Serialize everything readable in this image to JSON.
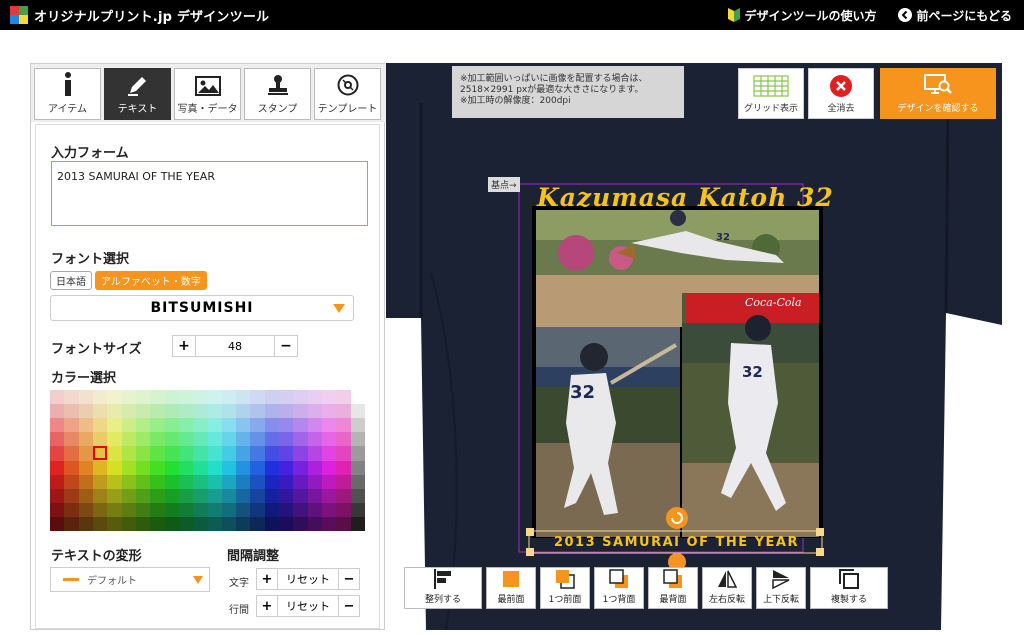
{
  "header": {
    "title": "オリジナルプリント.jp デザインツール",
    "guide_link": "デザインツールの使い方",
    "back_link": "前ページにもどる"
  },
  "tabs": [
    {
      "label": "アイテム",
      "icon": "info-icon"
    },
    {
      "label": "テキスト",
      "icon": "pen-icon"
    },
    {
      "label": "写真・データ",
      "icon": "image-icon"
    },
    {
      "label": "スタンプ",
      "icon": "stamp-icon"
    },
    {
      "label": "テンプレート",
      "icon": "template-icon"
    }
  ],
  "form": {
    "input_label": "入力フォーム",
    "input_value": "2013 SAMURAI OF THE YEAR",
    "font_label": "フォント選択",
    "font_tab_ja": "日本語",
    "font_tab_en": "アルファベット・数字",
    "font_selected": "BITSUMISHI",
    "size_label": "フォントサイズ",
    "size_value": "48",
    "color_label": "カラー選択",
    "transform_label": "テキストの変形",
    "transform_value": "デフォルト",
    "spacing_label": "間隔調整",
    "char_label": "文字",
    "line_label": "行間",
    "reset_label": "リセット"
  },
  "stage": {
    "notice_lines": [
      "※加工範囲いっぱいに画像を配置する場合は、",
      "2518×2991 pxが最適な大きさになります。",
      "※加工時の解像度：200dpi"
    ],
    "kiten_label": "基点→",
    "grid_button": "グリッド表示",
    "clear_button": "全消去",
    "confirm_button": "デザインを確認する",
    "shirt_color": "#1b2233",
    "design_title": "Kazumasa Katoh 32",
    "design_subtitle": "2013 SAMURAI OF THE YEAR",
    "photo_sign": "Coca-Cola",
    "jersey_numbers": [
      "32",
      "32",
      "32"
    ]
  },
  "bottom_bar": [
    {
      "label": "整列する",
      "icon": "align-icon"
    },
    {
      "label": "最前面",
      "icon": "bring-front-icon"
    },
    {
      "label": "1つ前面",
      "icon": "bring-forward-icon"
    },
    {
      "label": "1つ背面",
      "icon": "send-backward-icon"
    },
    {
      "label": "最背面",
      "icon": "send-back-icon"
    },
    {
      "label": "左右反転",
      "icon": "flip-horizontal-icon"
    },
    {
      "label": "上下反転",
      "icon": "flip-vertical-icon"
    },
    {
      "label": "複製する",
      "icon": "duplicate-icon"
    }
  ],
  "colors": {
    "accent": "#f7941d",
    "header_bg": "#000000",
    "active_tab": "#333333"
  }
}
